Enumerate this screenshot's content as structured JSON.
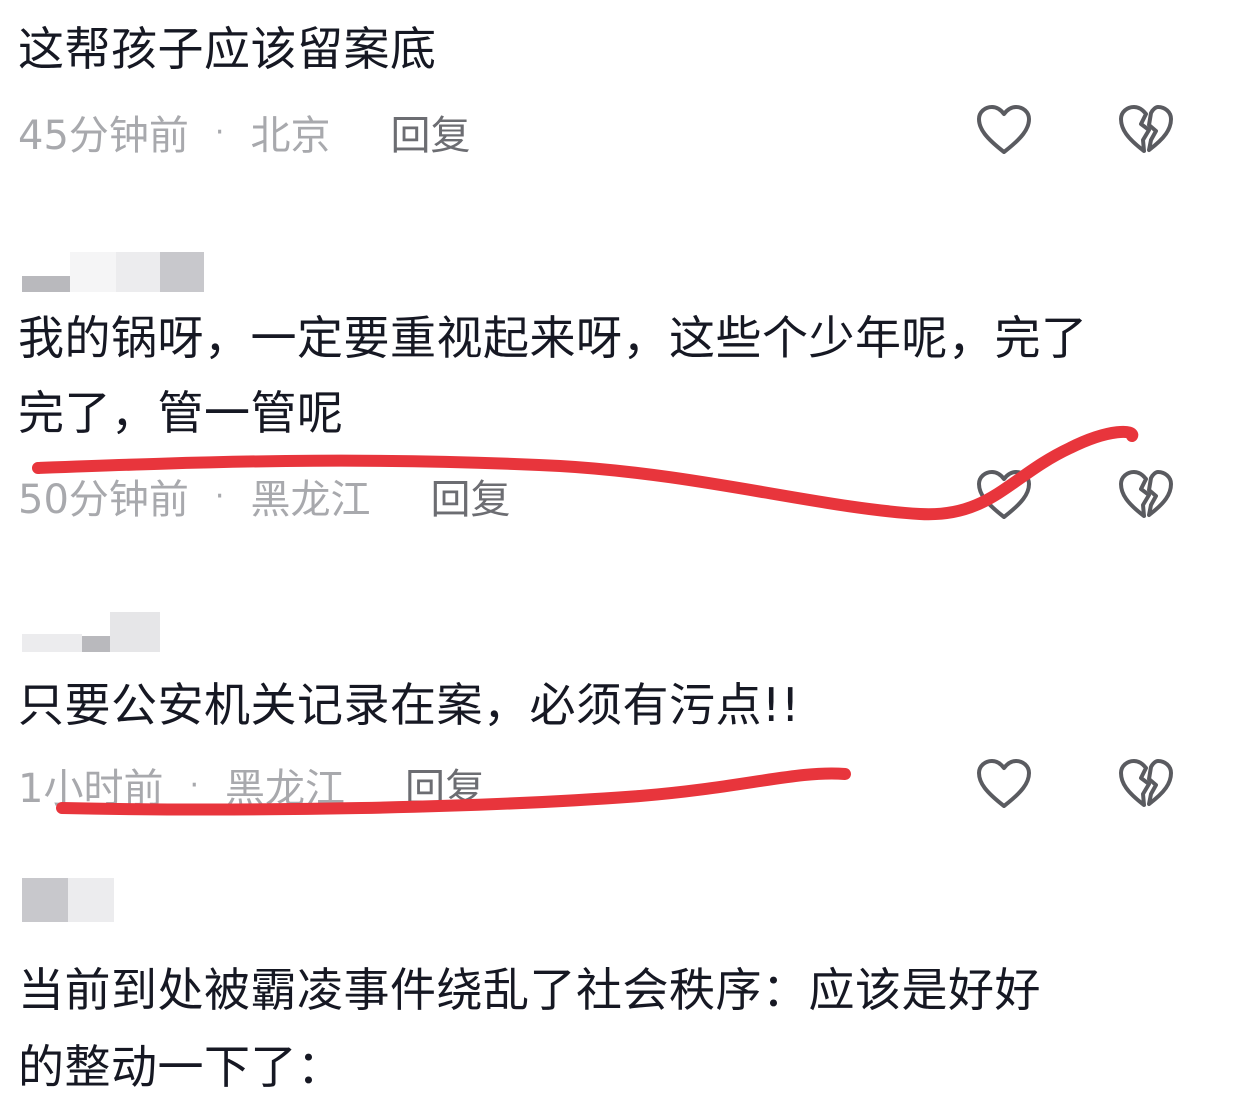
{
  "comments": [
    {
      "text_lines": [
        "这帮孩子应该留案底"
      ],
      "time": "45分钟前",
      "location": "北京",
      "separator": "·",
      "reply_label": "回复"
    },
    {
      "text_lines": [
        "我的锅呀，一定要重视起来呀，这些个少年呢，完了",
        "完了，管一管呢"
      ],
      "time": "50分钟前",
      "location": "黑龙江",
      "separator": "·",
      "reply_label": "回复"
    },
    {
      "text_lines": [
        "只要公安机关记录在案，必须有污点!!"
      ],
      "time": "1小时前",
      "location": "黑龙江",
      "separator": "·",
      "reply_label": "回复"
    },
    {
      "text_lines": [
        "当前到处被霸凌事件绕乱了社会秩序：应该是好好",
        "的整动一下了："
      ]
    }
  ],
  "icons": {
    "like": "heart-outline-icon",
    "dislike": "broken-heart-icon"
  },
  "colors": {
    "text": "#161823",
    "meta": "#a8a9ad",
    "reply": "#6c6d72",
    "icon": "#5a5b60",
    "annotation": "#e8353c",
    "blur": "#c8c8cc"
  }
}
